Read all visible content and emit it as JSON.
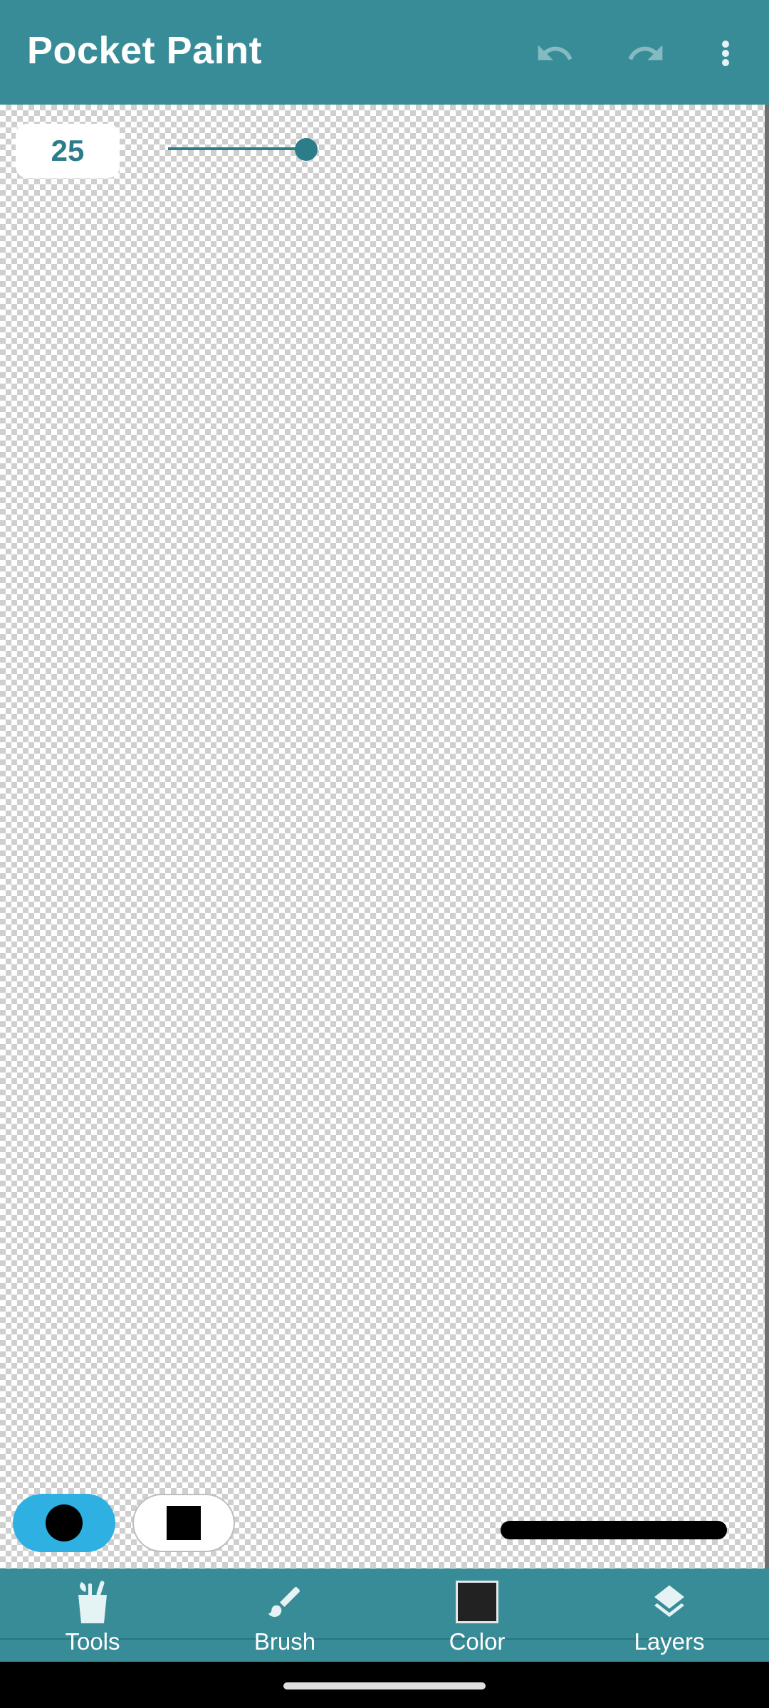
{
  "app": {
    "title": "Pocket Paint"
  },
  "toolbar": {
    "undo_icon": "undo-icon",
    "redo_icon": "redo-icon",
    "more_icon": "more-vert-icon"
  },
  "brush_size": {
    "value": "25",
    "slider_fraction": 0.25
  },
  "shapes": {
    "round_icon": "circle-icon",
    "square_icon": "square-icon",
    "selected": "round"
  },
  "bottom_nav": {
    "items": [
      {
        "label": "Tools",
        "icon": "tools-icon"
      },
      {
        "label": "Brush",
        "icon": "brush-icon"
      },
      {
        "label": "Color",
        "icon": "color-swatch-icon"
      },
      {
        "label": "Layers",
        "icon": "layers-icon"
      }
    ]
  },
  "colors": {
    "primary": "#388c98",
    "accent": "#2eb0e3",
    "current_color": "#222222"
  }
}
